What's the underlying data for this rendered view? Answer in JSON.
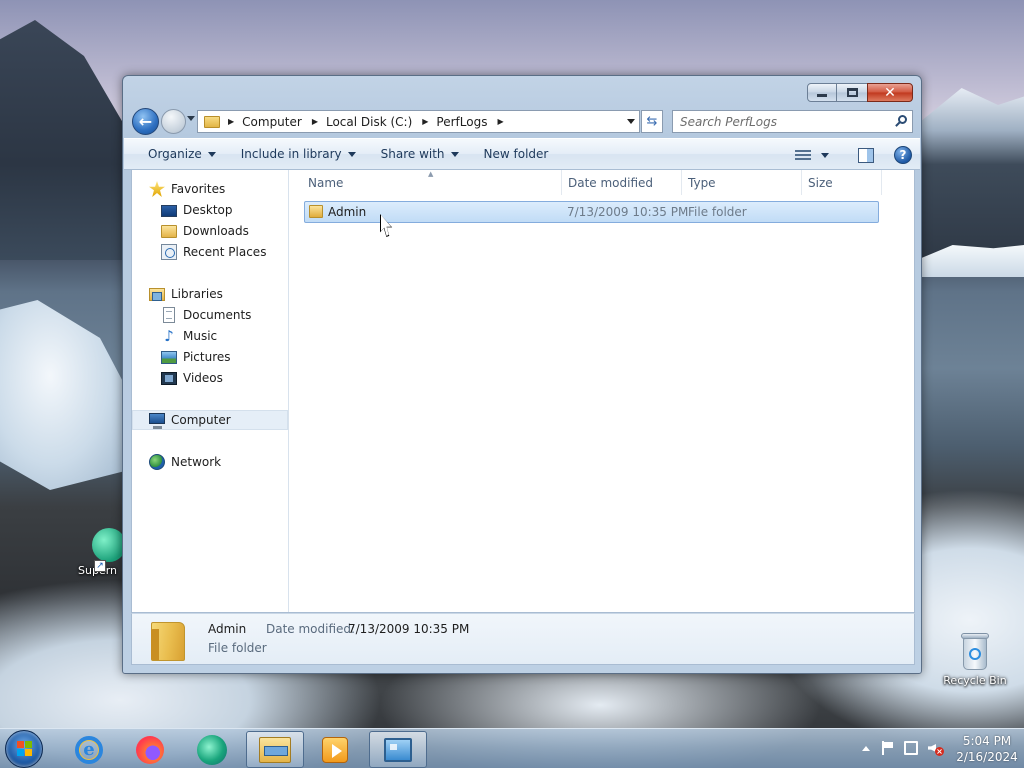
{
  "window": {
    "address_crumbs": [
      "Computer",
      "Local Disk (C:)",
      "PerfLogs"
    ],
    "search_placeholder": "Search PerfLogs",
    "toolbar": {
      "organize": "Organize",
      "include_in_library": "Include in library",
      "share_with": "Share with",
      "new_folder": "New folder"
    },
    "nav_pane": {
      "favorites_header": "Favorites",
      "favorites": [
        "Desktop",
        "Downloads",
        "Recent Places"
      ],
      "libraries_header": "Libraries",
      "libraries": [
        "Documents",
        "Music",
        "Pictures",
        "Videos"
      ],
      "computer": "Computer",
      "network": "Network"
    },
    "columns": {
      "name": "Name",
      "date_modified": "Date modified",
      "type": "Type",
      "size": "Size"
    },
    "files": [
      {
        "name": "Admin",
        "date_modified": "7/13/2009 10:35 PM",
        "type": "File folder",
        "size": ""
      }
    ],
    "details": {
      "name": "Admin",
      "type": "File folder",
      "date_label": "Date modified:",
      "date_value": "7/13/2009 10:35 PM"
    }
  },
  "desktop": {
    "icons": [
      {
        "label": "Recycle Bin",
        "icon": "recycle-bin-icon"
      },
      {
        "label": "Supern",
        "icon": "app-shortcut-icon"
      }
    ]
  },
  "taskbar": {
    "pinned": [
      "internet-explorer-icon",
      "firefox-icon",
      "edge-icon",
      "file-explorer-icon",
      "media-player-icon",
      "remote-desktop-icon"
    ],
    "clock_time": "5:04 PM",
    "clock_date": "2/16/2024"
  },
  "colors": {
    "selection_fill": "#c1dcf6",
    "selection_border": "#84acdd",
    "close_button": "#c0381d"
  }
}
